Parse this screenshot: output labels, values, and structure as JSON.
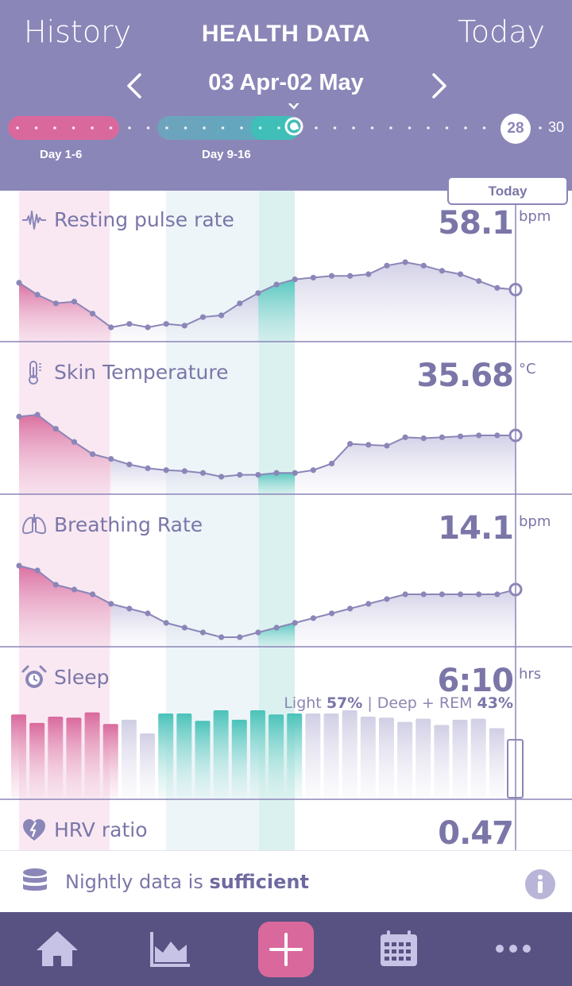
{
  "header": {
    "history_label": "History",
    "title": "HEALTH DATA",
    "today_label": "Today",
    "date_range": "03 Apr-02 May",
    "prev_icon": "chevron-left-icon",
    "next_icon": "chevron-right-icon"
  },
  "cycle": {
    "phase_1_label": "Day 1-6",
    "phase_2_label": "Day 9-16",
    "current_day": "28",
    "cycle_length": "30",
    "colors": {
      "period": "#d9699c",
      "fertile": "#6fa3bd",
      "ovulation": "#3fbfb7",
      "header_bg": "#8b86b8"
    }
  },
  "today_tab": "Today",
  "metrics": [
    {
      "id": "resting_pulse",
      "label": "Resting pulse rate",
      "value": "58.1",
      "unit": "bpm",
      "icon": "pulse-wave-icon"
    },
    {
      "id": "skin_temp",
      "label": "Skin Temperature",
      "value": "35.68",
      "unit": "°C",
      "icon": "thermometer-icon"
    },
    {
      "id": "breathing",
      "label": "Breathing Rate",
      "value": "14.1",
      "unit": "bpm",
      "icon": "lungs-icon"
    },
    {
      "id": "sleep",
      "label": "Sleep",
      "value": "6:10",
      "unit": "hrs",
      "icon": "alarm-clock-icon",
      "light_label": "Light",
      "light_pct": "57%",
      "sep": "|",
      "deep_label": "Deep + REM",
      "deep_pct": "43%"
    },
    {
      "id": "hrv",
      "label": "HRV ratio",
      "value": "0.47",
      "unit": "",
      "icon": "heart-bolt-icon"
    }
  ],
  "status": {
    "prefix": "Nightly data is",
    "emphasis": "sufficient",
    "icon": "database-icon",
    "info_icon": "info-icon"
  },
  "nav": {
    "items": [
      "home-icon",
      "trends-icon",
      "add-icon",
      "calendar-icon",
      "more-icon"
    ]
  },
  "chart_data": [
    {
      "type": "area",
      "title": "Resting pulse rate",
      "unit": "bpm",
      "days": 28,
      "values": [
        60.2,
        59.5,
        59.0,
        59.1,
        58.4,
        57.6,
        57.8,
        57.6,
        57.8,
        57.7,
        58.2,
        58.3,
        59.0,
        59.6,
        60.1,
        60.4,
        60.5,
        60.6,
        60.6,
        60.7,
        61.2,
        61.4,
        61.2,
        60.9,
        60.7,
        60.3,
        59.9,
        59.8
      ]
    },
    {
      "type": "area",
      "title": "Skin Temperature",
      "unit": "°C",
      "days": 28,
      "values": [
        35.95,
        35.97,
        35.82,
        35.68,
        35.55,
        35.5,
        35.44,
        35.4,
        35.38,
        35.37,
        35.35,
        35.31,
        35.33,
        35.33,
        35.35,
        35.35,
        35.38,
        35.45,
        35.66,
        35.65,
        35.64,
        35.73,
        35.72,
        35.73,
        35.74,
        35.75,
        35.75,
        35.75
      ]
    },
    {
      "type": "area",
      "title": "Breathing Rate",
      "unit": "bpm",
      "days": 28,
      "values": [
        14.8,
        14.7,
        14.4,
        14.3,
        14.2,
        14.0,
        13.9,
        13.8,
        13.6,
        13.5,
        13.4,
        13.3,
        13.3,
        13.4,
        13.5,
        13.6,
        13.7,
        13.8,
        13.9,
        14.0,
        14.1,
        14.2,
        14.2,
        14.2,
        14.2,
        14.2,
        14.2,
        14.3
      ]
    },
    {
      "type": "bar",
      "title": "Sleep",
      "unit": "hrs",
      "days": 28,
      "values": [
        7.9,
        7.1,
        7.7,
        7.6,
        8.1,
        7.0,
        7.4,
        6.1,
        8.0,
        8.0,
        7.3,
        8.3,
        7.4,
        8.3,
        7.9,
        8.0,
        8.0,
        8.0,
        8.3,
        7.7,
        7.6,
        7.2,
        7.5,
        6.9,
        7.4,
        7.5,
        6.6,
        5.5
      ]
    },
    {
      "type": "line",
      "title": "HRV ratio",
      "days": 28,
      "values": []
    }
  ]
}
